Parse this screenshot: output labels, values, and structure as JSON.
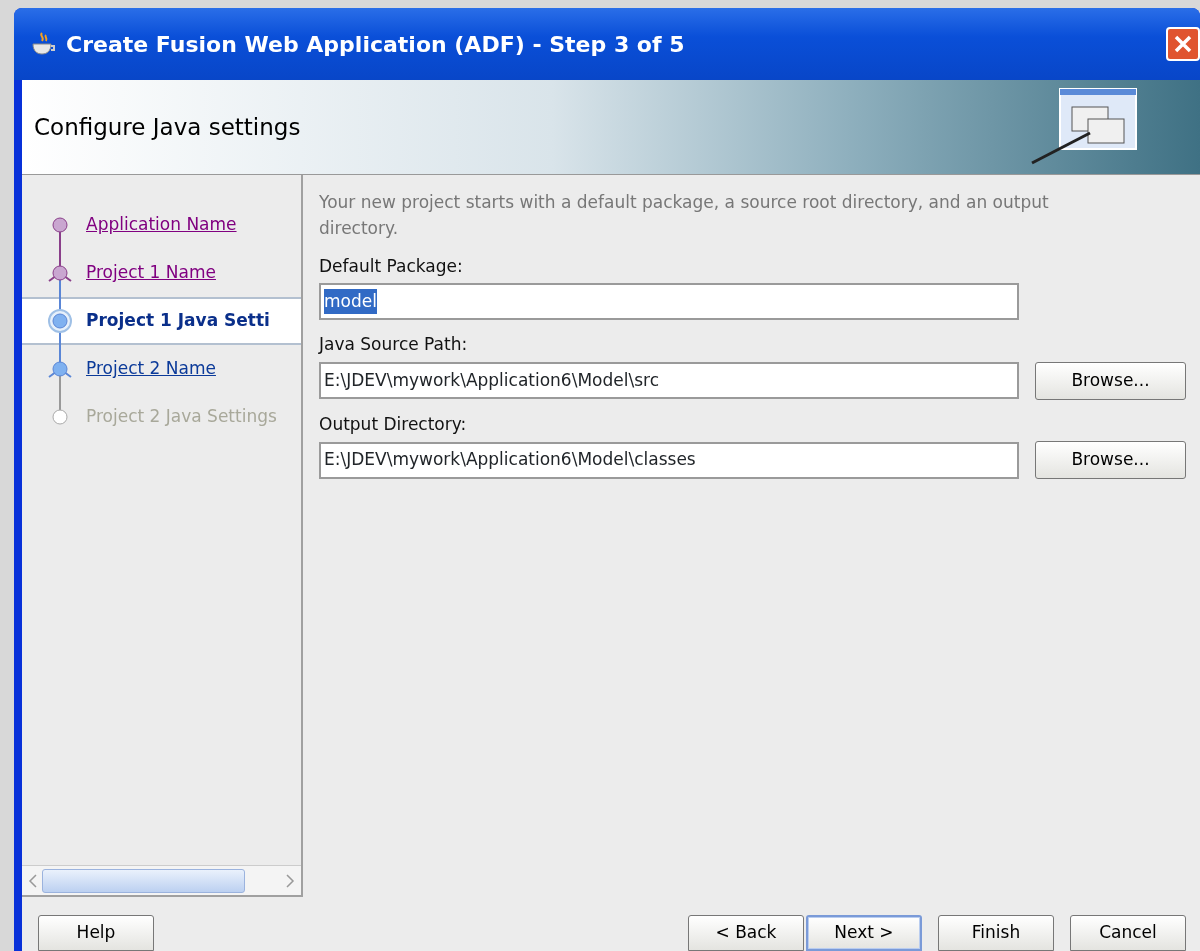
{
  "window": {
    "title": "Create Fusion Web Application (ADF) - Step 3 of 5"
  },
  "header": {
    "title": "Configure Java settings"
  },
  "steps": [
    {
      "label": "Application Name",
      "kind": "dot",
      "visited": true,
      "disabled": false,
      "selected": false
    },
    {
      "label": "Project 1 Name",
      "kind": "branch",
      "visited": true,
      "disabled": false,
      "selected": false
    },
    {
      "label": "Project 1 Java Setti",
      "kind": "dot",
      "visited": false,
      "disabled": false,
      "selected": true
    },
    {
      "label": "Project 2 Name",
      "kind": "branch",
      "visited": false,
      "disabled": false,
      "selected": false
    },
    {
      "label": "Project 2 Java Settings",
      "kind": "dot",
      "visited": false,
      "disabled": true,
      "selected": false
    }
  ],
  "intro": "Your new project starts with a default package, a source root directory, and an output directory.",
  "fields": [
    {
      "label": "Default Package:",
      "value": "model",
      "text_selected": true
    },
    {
      "label": "Java Source Path:",
      "value": "E:\\JDEV\\mywork\\Application6\\Model\\src",
      "text_selected": false,
      "button": "Browse..."
    },
    {
      "label": "Output Directory:",
      "value": "E:\\JDEV\\mywork\\Application6\\Model\\classes",
      "text_selected": false,
      "button": "Browse..."
    }
  ],
  "buttons": [
    {
      "label": "Help",
      "kind": "left",
      "default": false
    },
    {
      "label": "< Back",
      "kind": "right",
      "default": false
    },
    {
      "label": "Next >",
      "kind": "right",
      "default": true
    },
    {
      "label": "Finish",
      "kind": "right",
      "default": false
    },
    {
      "label": "Cancel",
      "kind": "right",
      "default": false
    }
  ]
}
